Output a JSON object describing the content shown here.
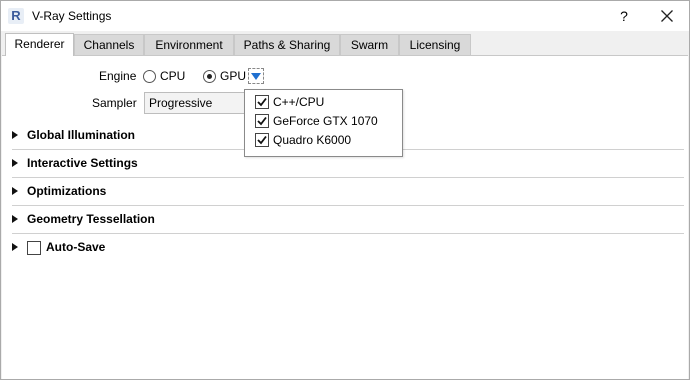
{
  "window": {
    "title": "V-Ray Settings",
    "app_icon_letter": "R"
  },
  "titlebar": {
    "help_label": "?"
  },
  "tabs": [
    {
      "label": "Renderer",
      "active": true
    },
    {
      "label": "Channels"
    },
    {
      "label": "Environment"
    },
    {
      "label": "Paths & Sharing"
    },
    {
      "label": "Swarm"
    },
    {
      "label": "Licensing"
    }
  ],
  "engine": {
    "label": "Engine",
    "options": [
      {
        "label": "CPU",
        "selected": false
      },
      {
        "label": "GPU",
        "selected": true
      }
    ]
  },
  "sampler": {
    "label": "Sampler",
    "value": "Progressive"
  },
  "device_dropdown": {
    "items": [
      {
        "label": "C++/CPU",
        "checked": true
      },
      {
        "label": "GeForce GTX 1070",
        "checked": true
      },
      {
        "label": "Quadro K6000",
        "checked": true
      }
    ]
  },
  "sections": [
    {
      "title": "Global Illumination"
    },
    {
      "title": "Interactive Settings"
    },
    {
      "title": "Optimizations"
    },
    {
      "title": "Geometry Tessellation"
    },
    {
      "title": "Auto-Save",
      "has_checkbox": true,
      "checked": false
    }
  ],
  "colors": {
    "accent": "#1f6fd0",
    "tab_bg": "#d9d9d9",
    "panel_bg": "#ffffff"
  }
}
